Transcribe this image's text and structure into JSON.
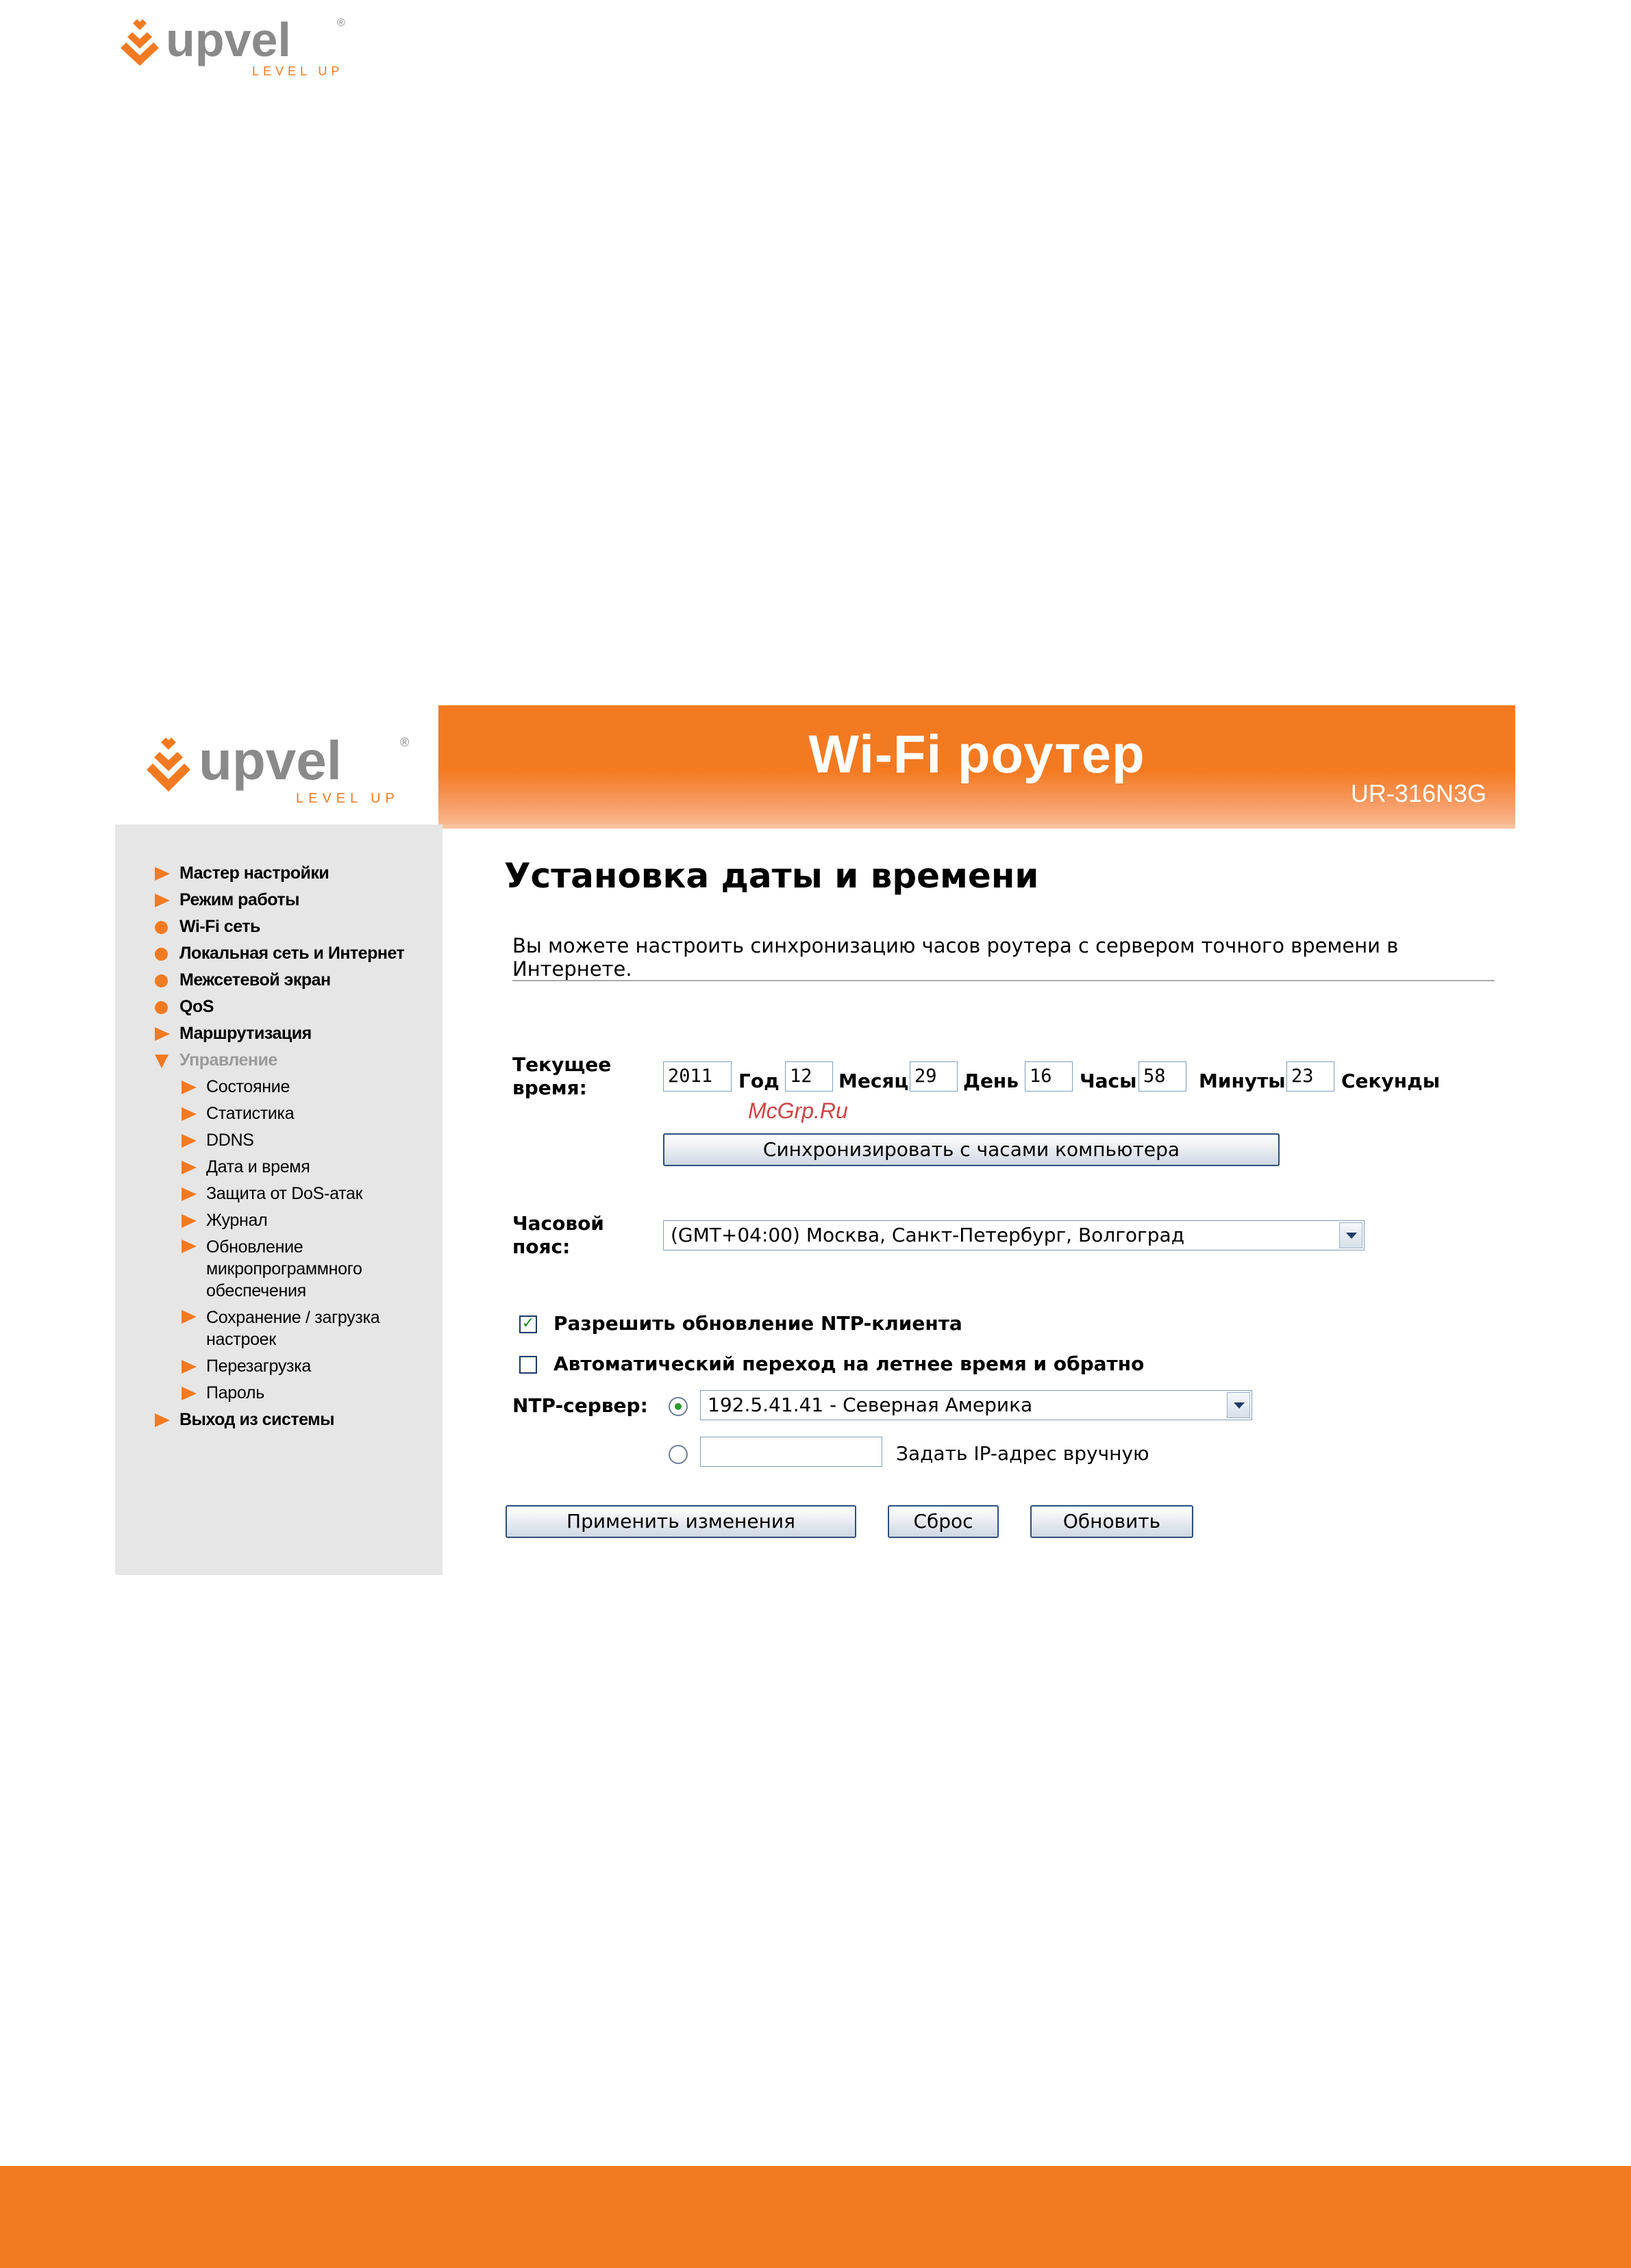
{
  "brand": {
    "name": "upvel",
    "tagline": "LEVEL UP",
    "registered": "®",
    "accent": "#f37a21",
    "gray": "#8a8a8a"
  },
  "header": {
    "title": "Wi-Fi роутер",
    "model": "UR-316N3G"
  },
  "sidebar": {
    "items": [
      {
        "label": "Мастер настройки"
      },
      {
        "label": "Режим работы"
      },
      {
        "label": "Wi-Fi сеть"
      },
      {
        "label": "Локальная сеть и Интернет"
      },
      {
        "label": "Межсетевой экран"
      },
      {
        "label": "QoS"
      },
      {
        "label": "Маршрутизация"
      },
      {
        "label": "Управление"
      }
    ],
    "subitems": [
      {
        "label": "Состояние"
      },
      {
        "label": "Статистика"
      },
      {
        "label": "DDNS"
      },
      {
        "label": "Дата и время"
      },
      {
        "label": "Защита от DoS-атак"
      },
      {
        "label": "Журнал"
      },
      {
        "lines": [
          "Обновление",
          "микропрограммного",
          "обеспечения"
        ]
      },
      {
        "lines": [
          "Сохранение / загрузка",
          "настроек"
        ]
      },
      {
        "label": "Перезагрузка"
      },
      {
        "label": "Пароль"
      }
    ],
    "logout": "Выход из системы"
  },
  "main": {
    "title": "Установка даты и времени",
    "description": "Вы можете настроить синхронизацию часов роутера с сервером точного времени в Интернете.",
    "current_time": {
      "label_line1": "Текущее",
      "label_line2": "время:",
      "year": "2011",
      "year_unit": "Год",
      "month": "12",
      "month_unit": "Месяц",
      "day": "29",
      "day_unit": "День",
      "hour": "16",
      "hour_unit": "Часы",
      "minute": "58",
      "minute_unit": "Минуты",
      "second": "23",
      "second_unit": "Секунды"
    },
    "sync_button": "Синхронизировать с часами компьютера",
    "timezone": {
      "label_line1": "Часовой",
      "label_line2": "пояс:",
      "value": "(GMT+04:00) Москва, Санкт-Петербург, Волгоград"
    },
    "ntp_enable": {
      "label": "Разрешить обновление NTP-клиента",
      "checked": true
    },
    "dst": {
      "label": "Автоматический переход на летнее время и обратно",
      "checked": false
    },
    "ntp_server": {
      "label": "NTP-сервер:",
      "preset_value": "192.5.41.41 - Северная Америка",
      "manual_value": "",
      "manual_label": "Задать IP-адрес вручную"
    },
    "buttons": {
      "apply": "Применить изменения",
      "reset": "Сброс",
      "refresh": "Обновить"
    }
  },
  "watermark": "McGrp.Ru"
}
